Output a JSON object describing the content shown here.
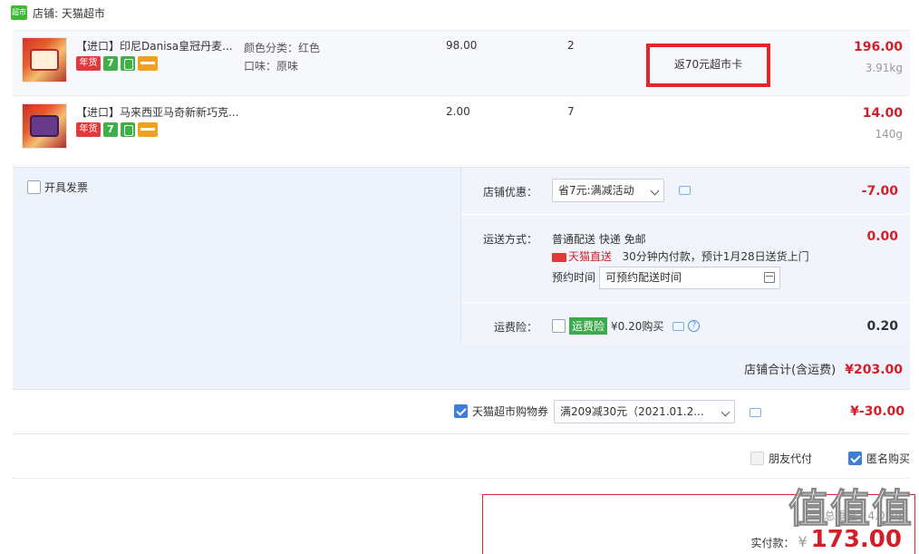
{
  "shop": {
    "logo_text": "超市",
    "name": "店铺: 天猫超市"
  },
  "items": [
    {
      "title": "【进口】印尼Danisa皇冠丹麦...",
      "sku": [
        "颜色分类：红色",
        "口味：原味"
      ],
      "price": "98.00",
      "qty": "2",
      "promo": "返70元超市卡",
      "subtotal": "196.00",
      "weight": "3.91kg",
      "badges": {
        "nianhuo": "年货",
        "seven": "7"
      }
    },
    {
      "title": "【进口】马来西亚马奇新新巧克...",
      "sku": [],
      "price": "2.00",
      "qty": "7",
      "promo": "",
      "subtotal": "14.00",
      "weight": "140g",
      "badges": {
        "nianhuo": "年货",
        "seven": "7"
      }
    }
  ],
  "invoice_label": "开具发票",
  "store_discount": {
    "label": "店铺优惠：",
    "selected": "省7元:满减活动",
    "amount": "-7.00"
  },
  "shipping": {
    "label": "运送方式：",
    "method": "普通配送 快递 免邮",
    "tmall_direct": "天猫直送",
    "note": "30分钟内付款，预计1月28日送货上门",
    "time_label": "预约时间",
    "time_placeholder": "可预约配送时间",
    "amount": "0.00"
  },
  "insurance": {
    "label": "运费险：",
    "badge": "运费险",
    "price": "¥0.20购买",
    "help": "?",
    "amount": "0.20"
  },
  "shop_total": {
    "label": "店铺合计(含运费)",
    "value": "¥203.00"
  },
  "coupon": {
    "label": "天猫超市购物券",
    "selected": "满209减30元（2021.01.2...",
    "amount": "¥-30.00"
  },
  "pay_options": {
    "friend_pay": "朋友代付",
    "anonymous": "匿名购买"
  },
  "summary": {
    "weight": "总重量：4.0 kg",
    "paid_label": "实付款：",
    "currency": "¥",
    "paid_value": "173.00"
  },
  "watermark": "值值值",
  "colors": {
    "price_red": "#d2202a",
    "accent_blue": "#3d7fd8",
    "promo_border": "#e0262b",
    "tmall_green": "#3fb838"
  }
}
